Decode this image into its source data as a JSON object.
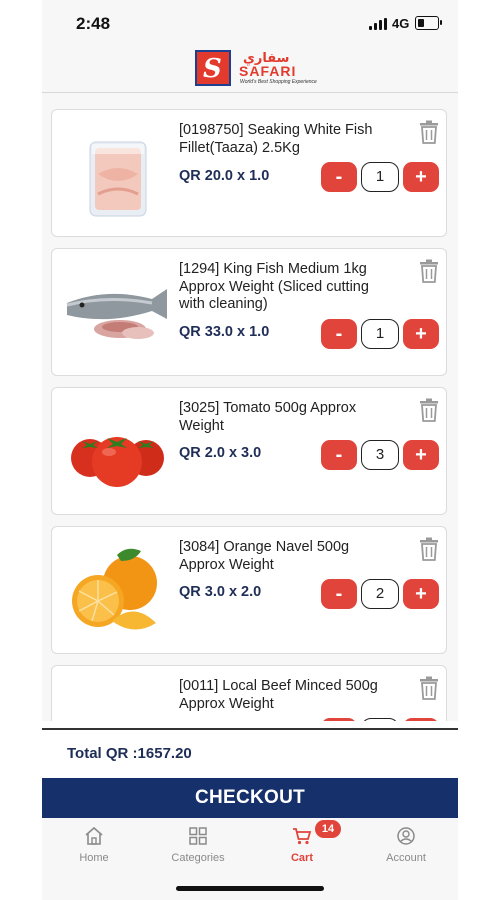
{
  "status_bar": {
    "time": "2:48",
    "network": "4G",
    "battery_level": 0.35
  },
  "header": {
    "brand_name": "SAFARI",
    "brand_arabic": "سفاري",
    "tagline": "World's Best Shopping Experience",
    "logo_icon": "safari-s-logo"
  },
  "colors": {
    "accent": "#e0443a",
    "brand_navy": "#15306b",
    "price_text": "#1f2e57"
  },
  "cart_items": [
    {
      "title": "[0198750] Seaking White Fish Fillet(Taaza) 2.5Kg",
      "price": "QR 20.0 x 1.0",
      "quantity": "1",
      "minus_label": "-",
      "plus_label": "+",
      "image_icon": "fish-fillet-pack"
    },
    {
      "title": "[1294] King Fish Medium 1kg Approx Weight (Sliced cutting with cleaning)",
      "price": "QR 33.0 x 1.0",
      "quantity": "1",
      "minus_label": "-",
      "plus_label": "+",
      "image_icon": "king-fish"
    },
    {
      "title": "[3025] Tomato 500g Approx Weight",
      "price": "QR 2.0 x 3.0",
      "quantity": "3",
      "minus_label": "-",
      "plus_label": "+",
      "image_icon": "tomatoes"
    },
    {
      "title": "[3084] Orange Navel 500g Approx Weight",
      "price": "QR 3.0 x 2.0",
      "quantity": "2",
      "minus_label": "-",
      "plus_label": "+",
      "image_icon": "oranges"
    },
    {
      "title": "[0011] Local Beef Minced 500g Approx Weight",
      "price": "",
      "quantity": "",
      "minus_label": "-",
      "plus_label": "+",
      "image_icon": "minced-beef"
    }
  ],
  "total": {
    "label": "Total QR :1657.20"
  },
  "checkout": {
    "label": "CHECKOUT"
  },
  "tabs": [
    {
      "label": "Home",
      "icon": "home-icon",
      "active": false
    },
    {
      "label": "Categories",
      "icon": "grid-icon",
      "active": false
    },
    {
      "label": "Cart",
      "icon": "cart-icon",
      "active": true,
      "badge": "14"
    },
    {
      "label": "Account",
      "icon": "user-icon",
      "active": false
    }
  ]
}
